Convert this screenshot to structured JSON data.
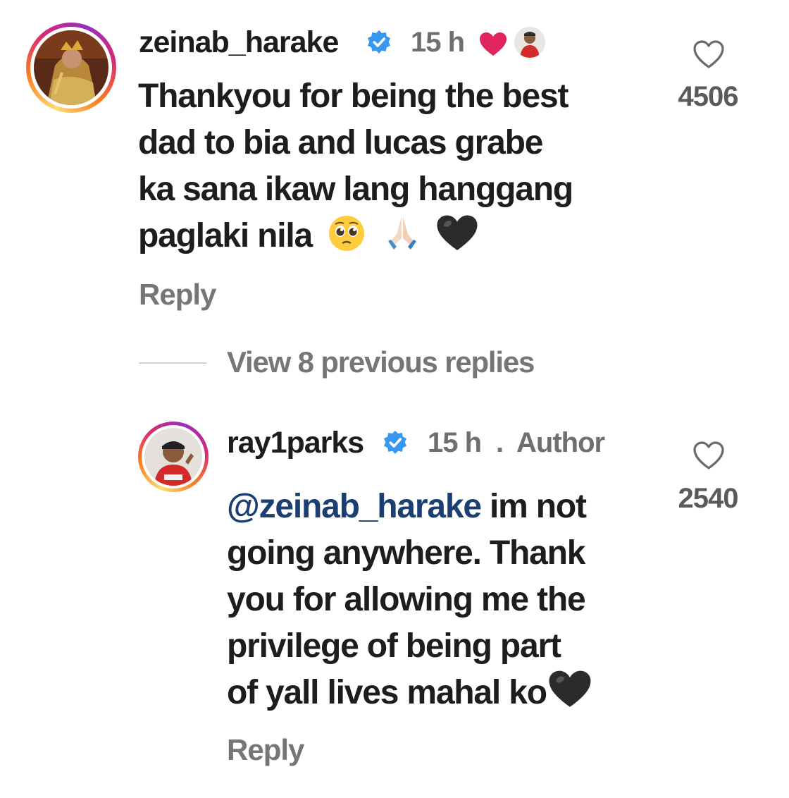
{
  "comment": {
    "username": "zeinab_harake",
    "time": "15 h",
    "text_lines": [
      "Thankyou for being the best",
      "dad to bia and lucas grabe",
      "ka sana ikaw lang hanggang",
      "paglaki nila"
    ],
    "reply_label": "Reply",
    "like_count": "4506",
    "liked_by_author_icon": "red-heart-icon"
  },
  "thread": {
    "view_replies_label": "View 8 previous replies"
  },
  "reply": {
    "username": "ray1parks",
    "time": "15 h",
    "separator": ".",
    "author_label": "Author",
    "mention": "@zeinab_harake",
    "text_lines": [
      " im not",
      "going anywhere. Thank",
      "you for allowing me the",
      "privilege of being part",
      "of yall lives mahal ko"
    ],
    "reply_label": "Reply",
    "like_count": "2540"
  },
  "colors": {
    "verified_blue": "#3897f0",
    "mention": "#1b3f73",
    "heart_red": "#e0245e",
    "muted": "#767676"
  }
}
